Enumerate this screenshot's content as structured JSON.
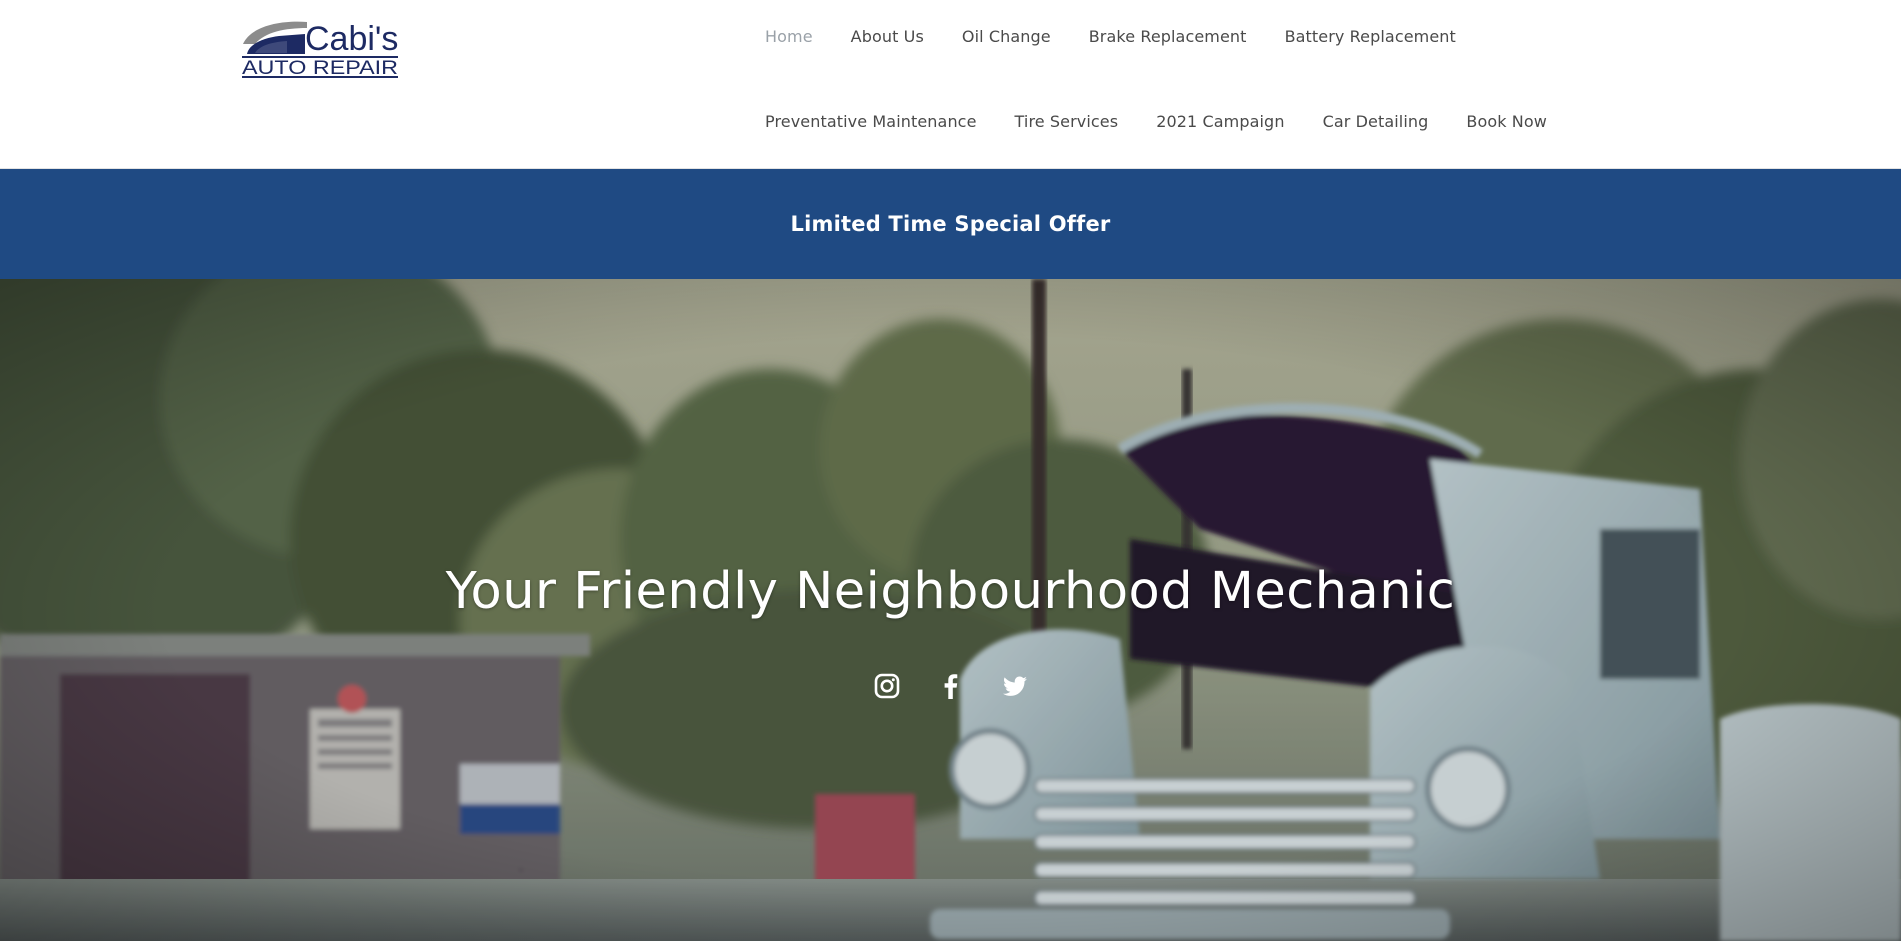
{
  "brand": {
    "name": "Cabi's",
    "tagline": "AUTO REPAIR",
    "colors": {
      "primary": "#1f4a83",
      "logo_navy": "#1d2a63",
      "logo_gray": "#8c8c8c"
    }
  },
  "nav": {
    "row1": [
      {
        "label": "Home",
        "active": true
      },
      {
        "label": "About Us"
      },
      {
        "label": "Oil Change"
      },
      {
        "label": "Brake Replacement"
      },
      {
        "label": "Battery Replacement"
      }
    ],
    "row2": [
      {
        "label": "Preventative Maintenance"
      },
      {
        "label": "Tire Services"
      },
      {
        "label": "2021 Campaign"
      },
      {
        "label": "Car Detailing"
      },
      {
        "label": "Book Now"
      }
    ]
  },
  "promo": {
    "label": "Limited Time Special Offer",
    "background": "#1f4a83"
  },
  "hero": {
    "title": "Your Friendly Neighbourhood Mechanic",
    "social": [
      {
        "name": "instagram-icon"
      },
      {
        "name": "facebook-icon"
      },
      {
        "name": "twitter-icon"
      }
    ]
  }
}
